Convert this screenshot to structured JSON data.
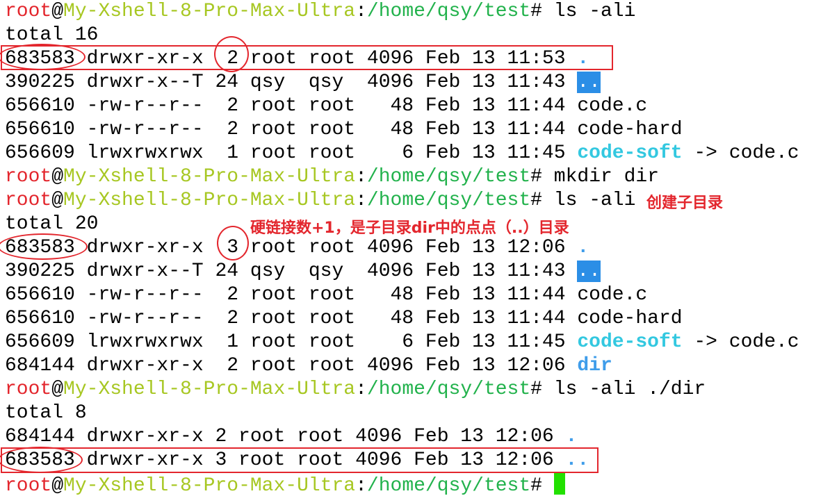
{
  "prompt": {
    "user": "root",
    "at": "@",
    "host": "My-Xshell-8-Pro-Max-Ultra",
    "colon": ":",
    "path": "/home/qsy/test",
    "symbol": "# "
  },
  "lines": {
    "l0_cmd": "ls -ali",
    "l1": "total 16",
    "l2": "683583 drwxr-xr-x  2 root root 4096 Feb 13 11:53 ",
    "l2_name": ".",
    "l3": "390225 drwxr-x--T 24 qsy  qsy  4096 Feb 13 11:43 ",
    "l3_name": "..",
    "l4": "656610 -rw-r--r--  2 root root   48 Feb 13 11:44 code.c",
    "l5": "656610 -rw-r--r--  2 root root   48 Feb 13 11:44 code-hard",
    "l6": "656609 lrwxrwxrwx  1 root root    6 Feb 13 11:45 ",
    "l6_name": "code-soft",
    "l6_target": " -> code.c",
    "l7_cmd": "mkdir dir",
    "l8_cmd": "ls -ali",
    "l9": "total 20",
    "l10": "683583 drwxr-xr-x  3 root root 4096 Feb 13 12:06 ",
    "l10_name": ".",
    "l11": "390225 drwxr-x--T 24 qsy  qsy  4096 Feb 13 11:43 ",
    "l11_name": "..",
    "l12": "656610 -rw-r--r--  2 root root   48 Feb 13 11:44 code.c",
    "l13": "656610 -rw-r--r--  2 root root   48 Feb 13 11:44 code-hard",
    "l14": "656609 lrwxrwxrwx  1 root root    6 Feb 13 11:45 ",
    "l14_name": "code-soft",
    "l14_target": " -> code.c",
    "l15": "684144 drwxr-xr-x  2 root root 4096 Feb 13 12:06 ",
    "l15_name": "dir",
    "l16_cmd": "ls -ali ./dir",
    "l17": "total 8",
    "l18": "684144 drwxr-xr-x 2 root root 4096 Feb 13 12:06 ",
    "l18_name": ".",
    "l19": "683583 drwxr-xr-x 3 root root 4096 Feb 13 12:06 ",
    "l19_name": ".."
  },
  "annotations": {
    "create_subdir": "创建子目录",
    "hardlink_note": "硬链接数+1，是子目录dir中的点点（..）目录"
  },
  "colors": {
    "accent": "#e3262d",
    "host": "#a7c722",
    "path": "#22b24c",
    "dir": "#3f9dea",
    "link": "#33c8e0",
    "cursor": "#22e000"
  }
}
